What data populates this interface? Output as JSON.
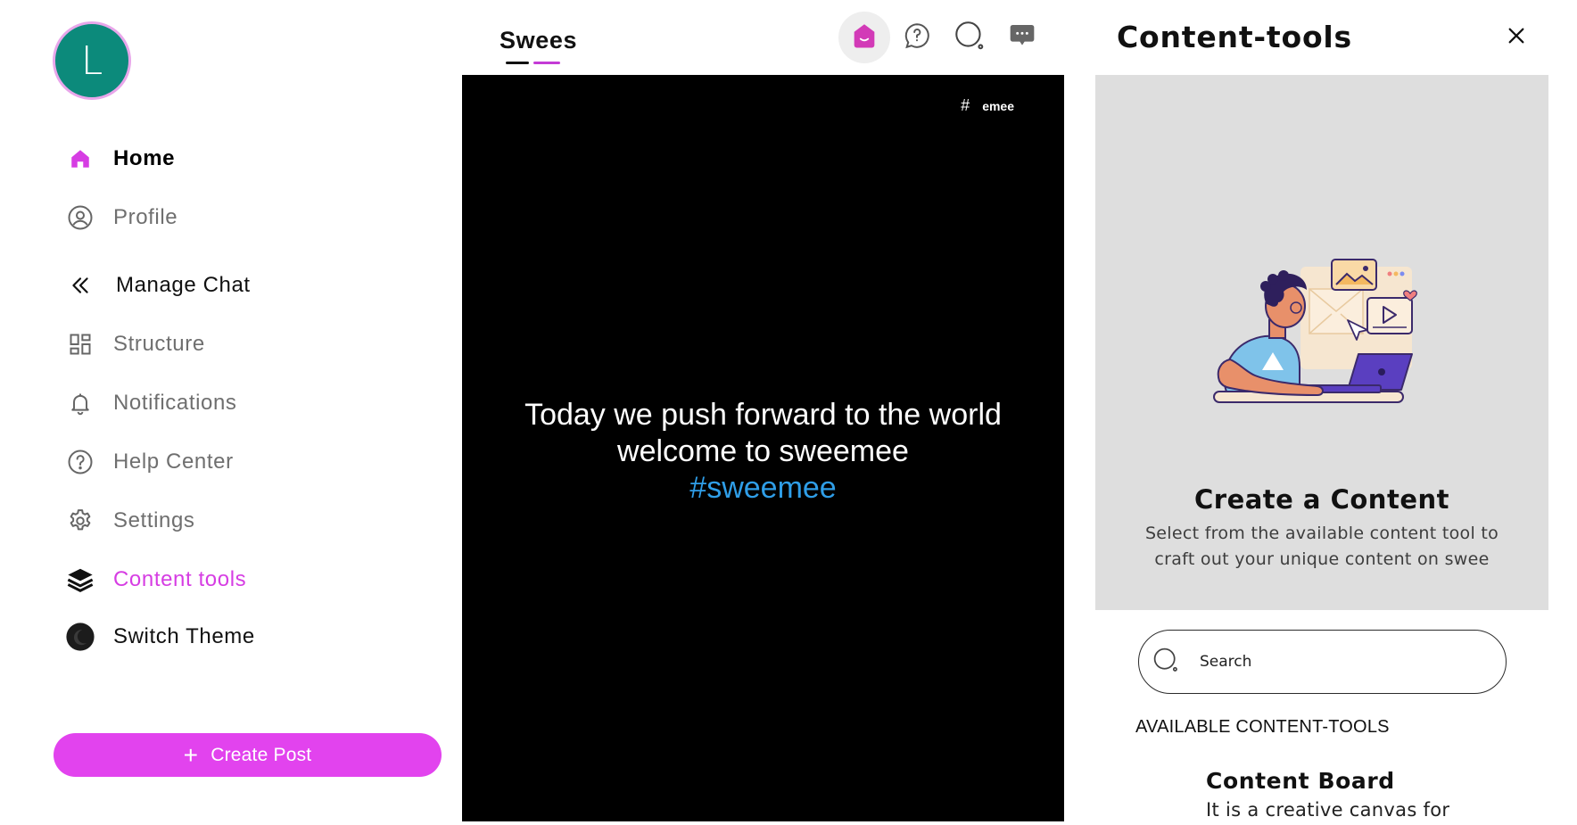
{
  "sidebar": {
    "avatar_initial": "L",
    "items": [
      {
        "label": "Home",
        "icon": "home-icon"
      },
      {
        "label": "Profile",
        "icon": "profile-icon"
      },
      {
        "label": "Manage Chat",
        "icon": "double-chevron-left-icon"
      },
      {
        "label": "Structure",
        "icon": "structure-grid-icon"
      },
      {
        "label": "Notifications",
        "icon": "bell-icon"
      },
      {
        "label": "Help Center",
        "icon": "help-circle-icon"
      },
      {
        "label": "Settings",
        "icon": "gear-icon"
      },
      {
        "label": "Content tools",
        "icon": "layers-icon"
      },
      {
        "label": "Switch Theme",
        "icon": "moon-icon"
      }
    ],
    "active_item": "Content tools",
    "create_post_label": "Create Post"
  },
  "feed": {
    "tab_label": "Swees",
    "header_icons": [
      "swees-home-icon",
      "chat-bubble-icon",
      "search-icon",
      "messages-icon"
    ],
    "post": {
      "tag_label": "#",
      "tag_text": "emee",
      "line1": "Today we push forward to the world",
      "line2": "welcome to sweemee",
      "hashtag": "#sweemee"
    }
  },
  "panel": {
    "title": "Content-tools",
    "hero_title": "Create a Content",
    "hero_subtitle": "Select from the available content tool to craft out your unique content on swee",
    "search_placeholder": "Search",
    "section_label": "AVAILABLE CONTENT-TOOLS",
    "tools": [
      {
        "name": "Content Board",
        "description": "It is a creative canvas for"
      }
    ]
  },
  "colors": {
    "accent": "#e243ee",
    "active_text": "#d63de3",
    "avatar_bg": "#0c8a7b",
    "hashtag": "#2f9ee8",
    "post_bg": "#000000",
    "hero_bg": "#dedede"
  }
}
